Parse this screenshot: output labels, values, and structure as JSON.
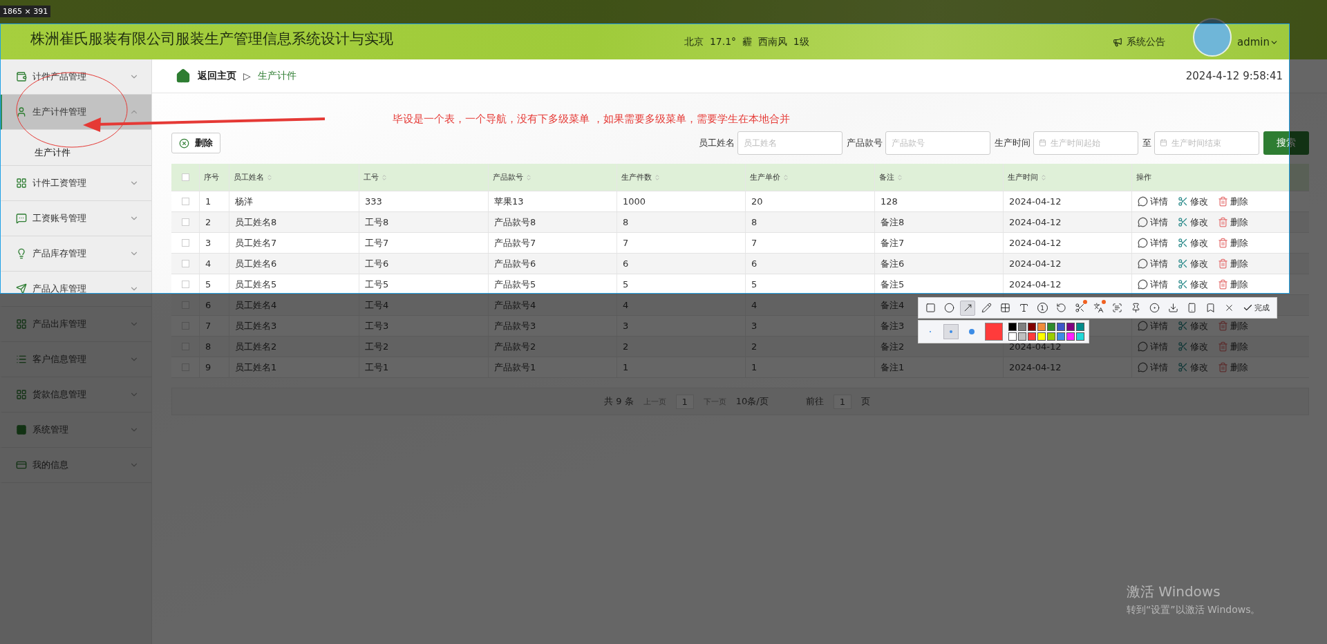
{
  "header": {
    "title": "株洲崔氏服装有限公司服装生产管理信息系统设计与实现",
    "weather": "北京  17.1°  霾  西南风  1级",
    "notice": "系统公告",
    "user": "admin"
  },
  "sidebar": {
    "items": [
      {
        "label": "计件产品管理",
        "expanded": false,
        "selected": false
      },
      {
        "label": "生产计件管理",
        "expanded": true,
        "selected": true,
        "children": [
          {
            "label": "生产计件"
          }
        ]
      },
      {
        "label": "计件工资管理",
        "expanded": false,
        "selected": false
      },
      {
        "label": "工资账号管理",
        "expanded": false,
        "selected": false
      },
      {
        "label": "产品库存管理",
        "expanded": false,
        "selected": false
      },
      {
        "label": "产品入库管理",
        "expanded": false,
        "selected": false
      },
      {
        "label": "产品出库管理",
        "expanded": false,
        "selected": false
      },
      {
        "label": "客户信息管理",
        "expanded": false,
        "selected": false
      },
      {
        "label": "货款信息管理",
        "expanded": false,
        "selected": false
      },
      {
        "label": "系统管理",
        "expanded": false,
        "selected": false
      },
      {
        "label": "我的信息",
        "expanded": false,
        "selected": false
      }
    ]
  },
  "breadcrumb": {
    "home": "返回主页",
    "separator": "▷",
    "current": "生产计件",
    "datetime": "2024-4-12 9:58:41"
  },
  "annotation": {
    "text": "毕设是一个表，一个导航，没有下多级菜单 ，如果需要多级菜单，需要学生在本地合并"
  },
  "toolbar": {
    "delete": "删除",
    "filters": [
      {
        "kind": "text",
        "label": "员工姓名",
        "placeholder": "员工姓名"
      },
      {
        "kind": "text",
        "label": "产品款号",
        "placeholder": "产品款号"
      },
      {
        "kind": "date",
        "label": "生产时间",
        "placeholder": "生产时间起始"
      },
      {
        "kind": "date",
        "label": "至",
        "placeholder": "生产时间结束"
      }
    ],
    "search": "搜索"
  },
  "table": {
    "select_all_checked": false,
    "columns": [
      {
        "label": "序号",
        "sortable": false
      },
      {
        "label": "员工姓名",
        "sortable": true
      },
      {
        "label": "工号",
        "sortable": true
      },
      {
        "label": "产品款号",
        "sortable": true
      },
      {
        "label": "生产件数",
        "sortable": true
      },
      {
        "label": "生产单价",
        "sortable": true
      },
      {
        "label": "备注",
        "sortable": true
      },
      {
        "label": "生产时间",
        "sortable": true
      },
      {
        "label": "操作",
        "sortable": false
      }
    ],
    "rows": [
      {
        "checked": false,
        "cells": [
          "1",
          "杨洋",
          "333",
          "苹果13",
          "1000",
          "20",
          "128",
          "2024-04-12"
        ],
        "actions": [
          "详情",
          "修改",
          "删除"
        ]
      },
      {
        "checked": false,
        "cells": [
          "2",
          "员工姓名8",
          "工号8",
          "产品款号8",
          "8",
          "8",
          "备注8",
          "2024-04-12"
        ],
        "actions": [
          "详情",
          "修改",
          "删除"
        ]
      },
      {
        "checked": false,
        "cells": [
          "3",
          "员工姓名7",
          "工号7",
          "产品款号7",
          "7",
          "7",
          "备注7",
          "2024-04-12"
        ],
        "actions": [
          "详情",
          "修改",
          "删除"
        ]
      },
      {
        "checked": false,
        "cells": [
          "4",
          "员工姓名6",
          "工号6",
          "产品款号6",
          "6",
          "6",
          "备注6",
          "2024-04-12"
        ],
        "actions": [
          "详情",
          "修改",
          "删除"
        ]
      },
      {
        "checked": false,
        "cells": [
          "5",
          "员工姓名5",
          "工号5",
          "产品款号5",
          "5",
          "5",
          "备注5",
          "2024-04-12"
        ],
        "actions": [
          "详情",
          "修改",
          "删除"
        ]
      },
      {
        "checked": false,
        "cells": [
          "6",
          "员工姓名4",
          "工号4",
          "产品款号4",
          "4",
          "4",
          "备注4"
        ],
        "actions": []
      },
      {
        "checked": false,
        "cells": [
          "7",
          "员工姓名3",
          "工号3",
          "产品款号3",
          "3",
          "3",
          "备注3"
        ],
        "actions": [
          "详情",
          "修改",
          "删除"
        ]
      },
      {
        "checked": false,
        "cells": [
          "8",
          "员工姓名2",
          "工号2",
          "产品款号2",
          "2",
          "2",
          "备注2",
          "2024-04-12"
        ],
        "actions": [
          "详情",
          "修改",
          "删除"
        ]
      },
      {
        "checked": false,
        "cells": [
          "9",
          "员工姓名1",
          "工号1",
          "产品款号1",
          "1",
          "1",
          "备注1",
          "2024-04-12"
        ],
        "actions": [
          "详情",
          "修改",
          "删除"
        ]
      }
    ]
  },
  "pagination": {
    "total": "共 9 条",
    "prev": "上一页",
    "page": "1",
    "next": "下一页",
    "page_size": "10条/页",
    "goto": "前往",
    "goto_value": "1",
    "unit": "页"
  },
  "capture": {
    "size_label": "1865 × 391",
    "tools": [
      {
        "kind": "rect",
        "selected": false,
        "badge": false
      },
      {
        "kind": "ellipse",
        "selected": false,
        "badge": false
      },
      {
        "kind": "arrow",
        "selected": true,
        "badge": false
      },
      {
        "kind": "pen",
        "selected": false,
        "badge": false
      },
      {
        "kind": "mosaic",
        "selected": false,
        "badge": false
      },
      {
        "kind": "text",
        "selected": false,
        "badge": false
      },
      {
        "kind": "number",
        "label": "1",
        "selected": false,
        "badge": false
      },
      {
        "kind": "undo",
        "selected": false,
        "badge": false
      },
      {
        "kind": "cut",
        "selected": false,
        "badge": true
      },
      {
        "kind": "translate",
        "selected": false,
        "badge": true
      },
      {
        "kind": "scan",
        "selected": false,
        "badge": false
      },
      {
        "kind": "pin",
        "selected": false,
        "badge": false
      },
      {
        "kind": "record",
        "selected": false,
        "badge": false
      },
      {
        "kind": "download",
        "selected": false,
        "badge": false
      },
      {
        "kind": "phone",
        "selected": false,
        "badge": false
      },
      {
        "kind": "bookmark",
        "selected": false,
        "badge": false
      },
      {
        "kind": "close",
        "selected": false,
        "badge": false
      }
    ],
    "done": "完成",
    "pen_sizes": [
      {
        "selected": false
      },
      {
        "selected": true
      },
      {
        "selected": false
      }
    ],
    "current_swatch": {
      "color": "#ff3b3b"
    },
    "palette": [
      {
        "color": "#000000"
      },
      {
        "color": "#808080"
      },
      {
        "color": "#800000"
      },
      {
        "color": "#f08c3c"
      },
      {
        "color": "#2e8b2e"
      },
      {
        "color": "#3c55c8"
      },
      {
        "color": "#800080"
      },
      {
        "color": "#008b8b"
      },
      {
        "color": "#ffffff"
      },
      {
        "color": "#c0c0c0"
      },
      {
        "color": "#ff3b3b"
      },
      {
        "color": "#ffff00"
      },
      {
        "color": "#99cc00"
      },
      {
        "color": "#3c8ce6"
      },
      {
        "color": "#ff20ff"
      },
      {
        "color": "#20d8d8"
      }
    ]
  },
  "os_notice": {
    "title": "激活 Windows",
    "subtitle": "转到“设置”以激活 Windows。"
  }
}
